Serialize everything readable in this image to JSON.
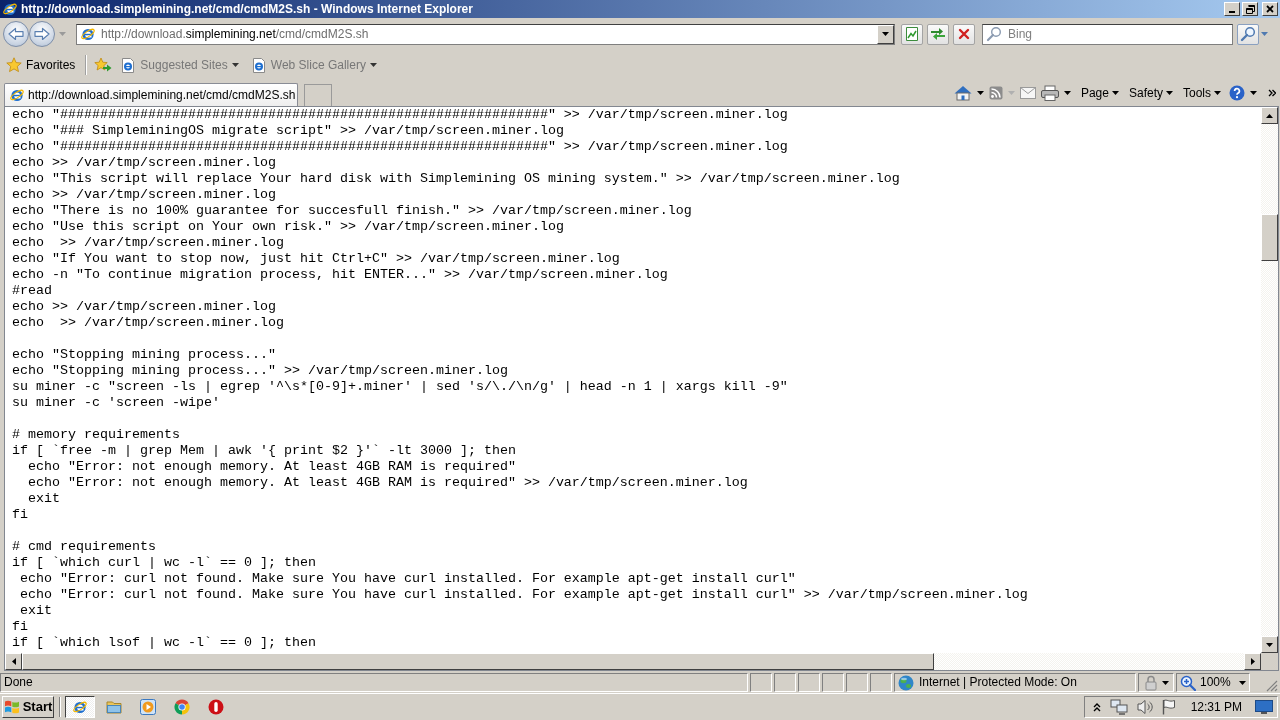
{
  "window": {
    "title": "http://download.simplemining.net/cmd/cmdM2S.sh - Windows Internet Explorer"
  },
  "address_bar": {
    "url": {
      "prefix": "http://download.",
      "domain": "simplemining.net",
      "path": "/cmd/cmdM2S.sh"
    }
  },
  "search": {
    "placeholder": "Bing"
  },
  "favorites_bar": {
    "label": "Favorites",
    "links": [
      {
        "label": "Suggested Sites"
      },
      {
        "label": "Web Slice Gallery"
      }
    ]
  },
  "tabs": [
    {
      "label": "http://download.simplemining.net/cmd/cmdM2S.sh",
      "selected": true
    }
  ],
  "command_bar": {
    "menus": [
      {
        "label": "Page"
      },
      {
        "label": "Safety"
      },
      {
        "label": "Tools"
      }
    ]
  },
  "document": {
    "blocks": [
      [
        "echo \"#############################################################\" >> /var/tmp/screen.miner.log",
        "echo \"### SimpleminingOS migrate script\" >> /var/tmp/screen.miner.log",
        "echo \"#############################################################\" >> /var/tmp/screen.miner.log",
        "echo >> /var/tmp/screen.miner.log",
        "echo \"This script will replace Your hard disk with Simplemining OS mining system.\" >> /var/tmp/screen.miner.log",
        "echo >> /var/tmp/screen.miner.log",
        "echo \"There is no 100% guarantee for succesfull finish.\" >> /var/tmp/screen.miner.log",
        "echo \"Use this script on Your own risk.\" >> /var/tmp/screen.miner.log",
        "echo  >> /var/tmp/screen.miner.log",
        "echo \"If You want to stop now, just hit Ctrl+C\" >> /var/tmp/screen.miner.log",
        "echo -n \"To continue migration process, hit ENTER...\" >> /var/tmp/screen.miner.log",
        "#read",
        "echo >> /var/tmp/screen.miner.log",
        "echo  >> /var/tmp/screen.miner.log"
      ],
      [
        "echo \"Stopping mining process...\"",
        "echo \"Stopping mining process...\" >> /var/tmp/screen.miner.log",
        "su miner -c \"screen -ls | egrep '^\\s*[0-9]+.miner' | sed 's/\\./\\n/g' | head -n 1 | xargs kill -9\"",
        "su miner -c 'screen -wipe'"
      ],
      [
        "# memory requirements",
        "if [ `free -m | grep Mem | awk '{ print $2 }'` -lt 3000 ]; then",
        "  echo \"Error: not enough memory. At least 4GB RAM is required\"",
        "  echo \"Error: not enough memory. At least 4GB RAM is required\" >> /var/tmp/screen.miner.log",
        "  exit",
        "fi"
      ],
      [
        "# cmd requirements",
        "if [ `which curl | wc -l` == 0 ]; then",
        " echo \"Error: curl not found. Make sure You have curl installed. For example apt-get install curl\"",
        " echo \"Error: curl not found. Make sure You have curl installed. For example apt-get install curl\" >> /var/tmp/screen.miner.log",
        " exit",
        "fi",
        "if [ `which lsof | wc -l` == 0 ]; then"
      ]
    ]
  },
  "status_bar": {
    "text": "Done",
    "zone": "Internet | Protected Mode: On",
    "zoom": "100%"
  },
  "taskbar": {
    "start": "Start",
    "apps": [
      {
        "kind": "browser",
        "active": true
      },
      {
        "kind": "folder",
        "active": false
      },
      {
        "kind": "player",
        "active": false
      },
      {
        "kind": "wheel",
        "active": false
      },
      {
        "kind": "ring",
        "active": false
      }
    ],
    "clock": "12:31 PM"
  }
}
